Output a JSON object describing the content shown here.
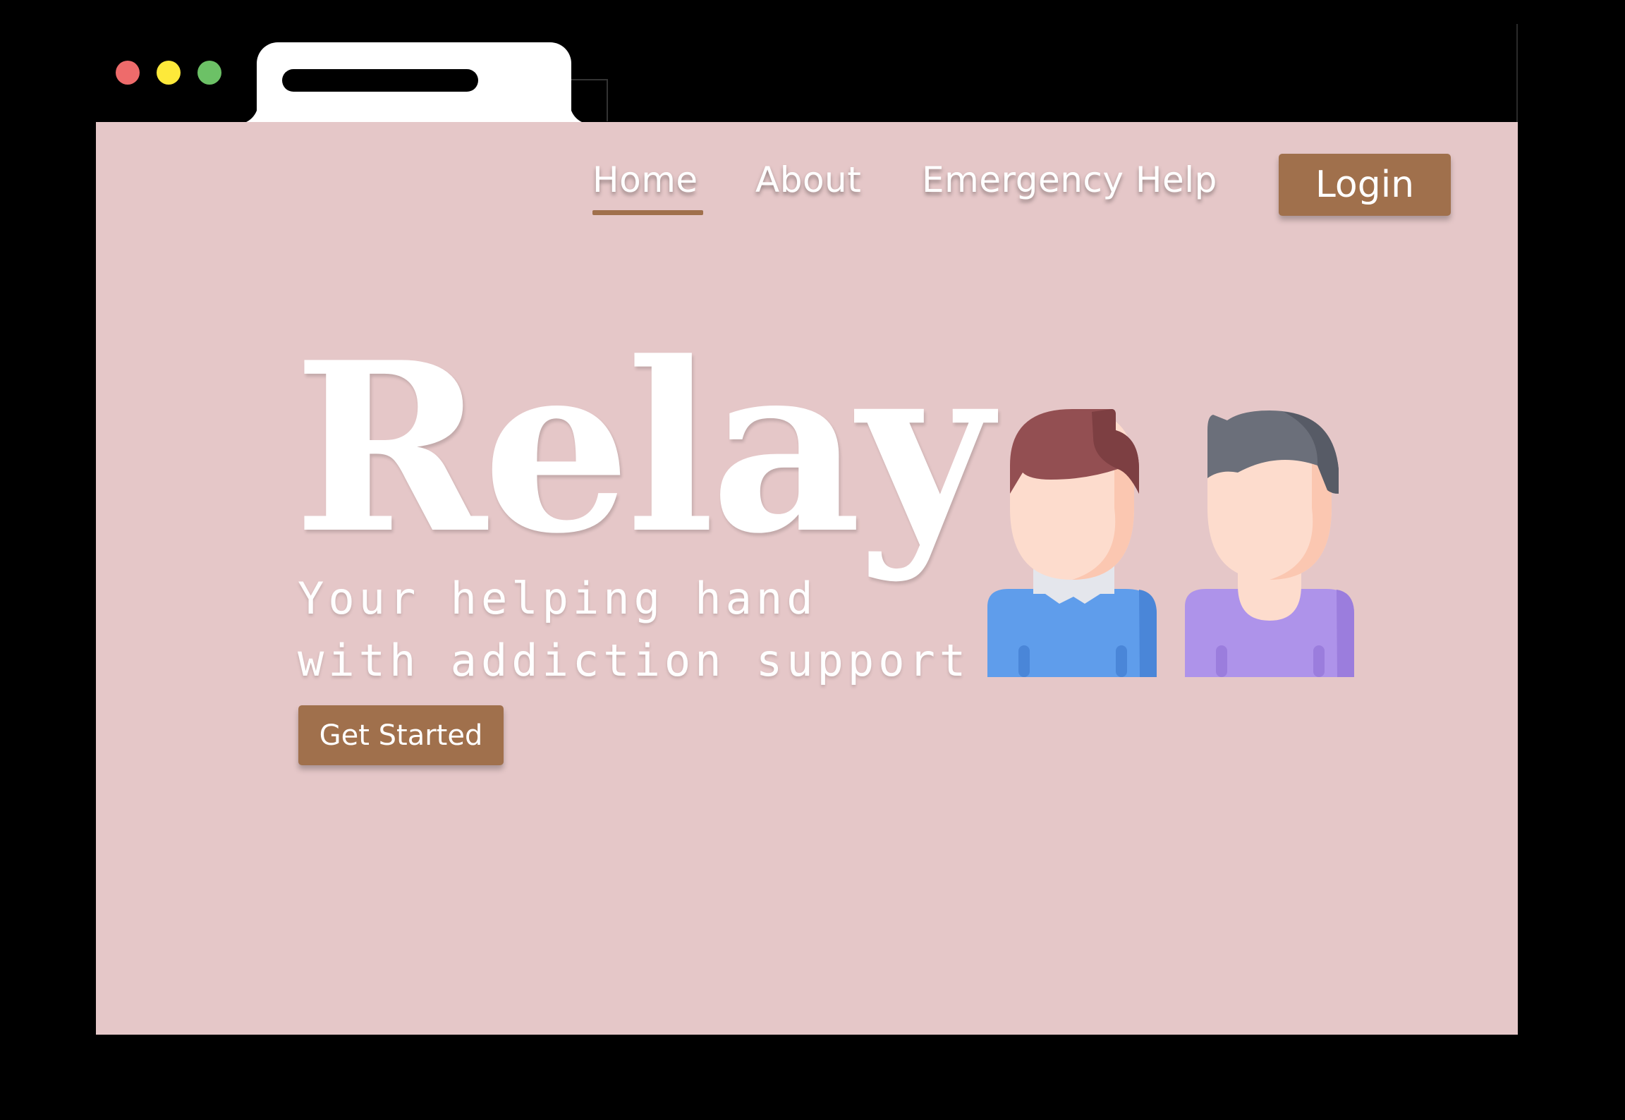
{
  "browser": {
    "window_controls": [
      "close",
      "minimize",
      "maximize"
    ],
    "colors": {
      "close": "#ee6b6b",
      "minimize": "#fde93a",
      "maximize": "#6cc166"
    }
  },
  "nav": {
    "links": [
      {
        "label": "Home",
        "active": true
      },
      {
        "label": "About",
        "active": false
      },
      {
        "label": "Emergency Help",
        "active": false
      }
    ],
    "login_label": "Login"
  },
  "hero": {
    "title": "Relay",
    "subtitle_line1": "Your helping hand",
    "subtitle_line2": "with addiction support",
    "cta_label": "Get Started",
    "illustration": "two-people-avatars-icon"
  },
  "colors": {
    "page_background": "#e5c7c8",
    "accent": "#a0704c",
    "text": "#ffffff"
  }
}
